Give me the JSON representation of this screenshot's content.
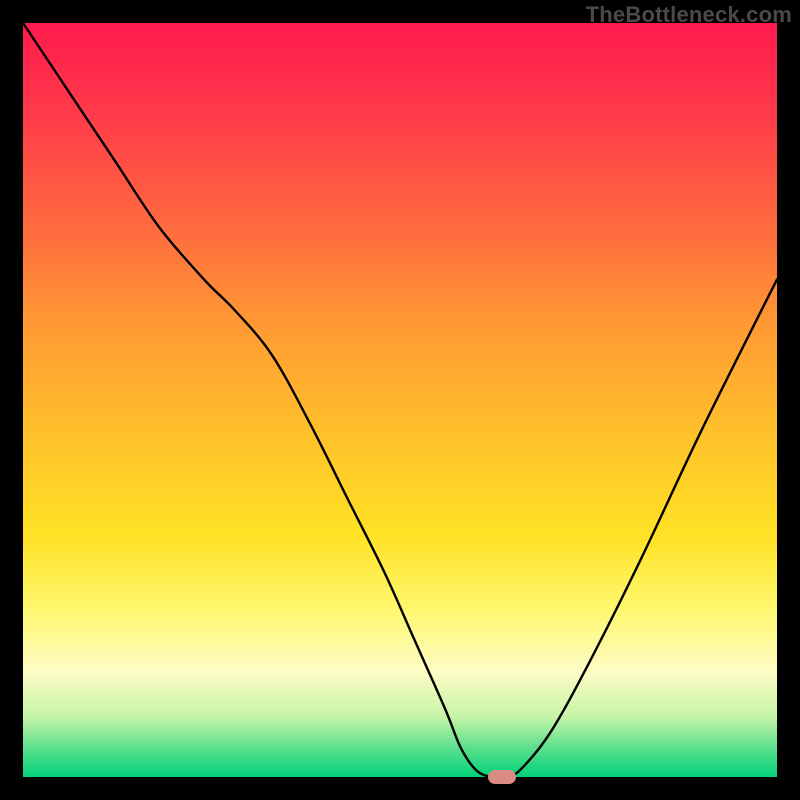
{
  "watermark": "TheBottleneck.com",
  "chart_data": {
    "type": "line",
    "title": "",
    "xlabel": "",
    "ylabel": "",
    "xlim": [
      0,
      100
    ],
    "ylim": [
      0,
      100
    ],
    "grid": false,
    "legend": false,
    "background": "red-yellow-green vertical gradient",
    "series": [
      {
        "name": "bottleneck-curve",
        "x": [
          0,
          6,
          12,
          18,
          24,
          28,
          33,
          38,
          43,
          48,
          52,
          56,
          58,
          60,
          62,
          64,
          66,
          70,
          75,
          82,
          90,
          100
        ],
        "y": [
          100,
          91,
          82,
          73,
          66,
          62,
          56,
          47,
          37,
          27,
          18,
          9,
          4,
          1,
          0,
          0,
          1,
          6,
          15,
          29,
          46,
          66
        ]
      }
    ],
    "marker": {
      "x": 63.5,
      "y": 0,
      "color": "#d98b84",
      "shape": "pill"
    },
    "gradient_stops": [
      {
        "pos": 0,
        "color": "#ff1a4d"
      },
      {
        "pos": 12,
        "color": "#ff3a4a"
      },
      {
        "pos": 27,
        "color": "#ff6a3f"
      },
      {
        "pos": 40,
        "color": "#ff9933"
      },
      {
        "pos": 55,
        "color": "#ffc22a"
      },
      {
        "pos": 68,
        "color": "#ffe225"
      },
      {
        "pos": 78,
        "color": "#fff870"
      },
      {
        "pos": 86,
        "color": "#fdfcc5"
      },
      {
        "pos": 92,
        "color": "#c6f5a7"
      },
      {
        "pos": 96,
        "color": "#5fe08d"
      },
      {
        "pos": 100,
        "color": "#00d27a"
      }
    ]
  }
}
